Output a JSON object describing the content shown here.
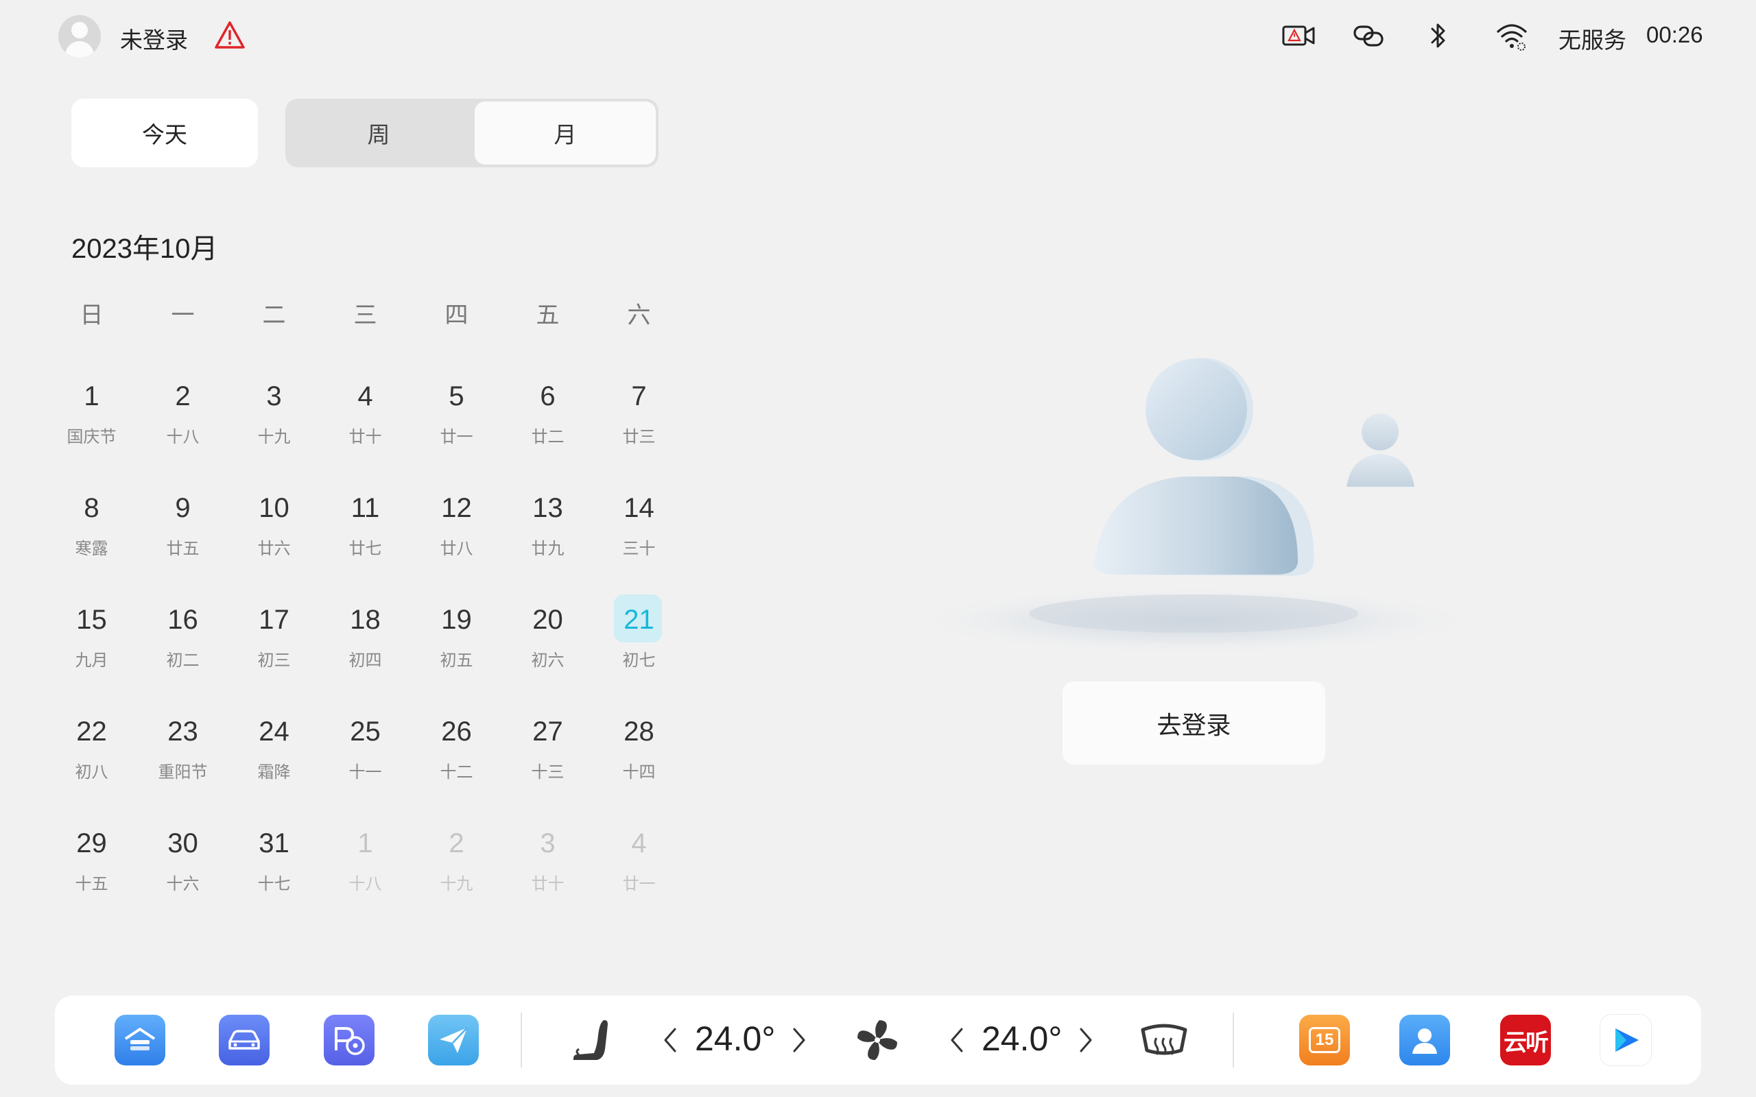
{
  "status_bar": {
    "user_label": "未登录",
    "network": "无服务",
    "time": "00:26"
  },
  "view_switch": {
    "today": "今天",
    "week": "周",
    "month": "月",
    "selected": "月"
  },
  "calendar": {
    "month_title": "2023年10月",
    "weekdays": [
      "日",
      "一",
      "二",
      "三",
      "四",
      "五",
      "六"
    ],
    "days": [
      {
        "num": "1",
        "lunar": "国庆节"
      },
      {
        "num": "2",
        "lunar": "十八"
      },
      {
        "num": "3",
        "lunar": "十九"
      },
      {
        "num": "4",
        "lunar": "廿十"
      },
      {
        "num": "5",
        "lunar": "廿一"
      },
      {
        "num": "6",
        "lunar": "廿二"
      },
      {
        "num": "7",
        "lunar": "廿三"
      },
      {
        "num": "8",
        "lunar": "寒露"
      },
      {
        "num": "9",
        "lunar": "廿五"
      },
      {
        "num": "10",
        "lunar": "廿六"
      },
      {
        "num": "11",
        "lunar": "廿七"
      },
      {
        "num": "12",
        "lunar": "廿八"
      },
      {
        "num": "13",
        "lunar": "廿九"
      },
      {
        "num": "14",
        "lunar": "三十"
      },
      {
        "num": "15",
        "lunar": "九月"
      },
      {
        "num": "16",
        "lunar": "初二"
      },
      {
        "num": "17",
        "lunar": "初三"
      },
      {
        "num": "18",
        "lunar": "初四"
      },
      {
        "num": "19",
        "lunar": "初五"
      },
      {
        "num": "20",
        "lunar": "初六"
      },
      {
        "num": "21",
        "lunar": "初七",
        "today": true
      },
      {
        "num": "22",
        "lunar": "初八"
      },
      {
        "num": "23",
        "lunar": "重阳节"
      },
      {
        "num": "24",
        "lunar": "霜降"
      },
      {
        "num": "25",
        "lunar": "十一"
      },
      {
        "num": "26",
        "lunar": "十二"
      },
      {
        "num": "27",
        "lunar": "十三"
      },
      {
        "num": "28",
        "lunar": "十四"
      },
      {
        "num": "29",
        "lunar": "十五"
      },
      {
        "num": "30",
        "lunar": "十六"
      },
      {
        "num": "31",
        "lunar": "十七"
      },
      {
        "num": "1",
        "lunar": "十八",
        "other": true
      },
      {
        "num": "2",
        "lunar": "十九",
        "other": true
      },
      {
        "num": "3",
        "lunar": "廿十",
        "other": true
      },
      {
        "num": "4",
        "lunar": "廿一",
        "other": true
      }
    ]
  },
  "login": {
    "button_label": "去登录"
  },
  "dock": {
    "left_temp": "24.0°",
    "right_temp": "24.0°",
    "calendar_app_badge": "15",
    "music_app_label": "云听",
    "icons": [
      "home-icon",
      "car-icon",
      "parking-assist-icon",
      "navigation-icon",
      "seat-heat-icon",
      "fan-icon",
      "rear-defrost-icon",
      "calendar-app-icon",
      "contacts-app-icon",
      "music-app-icon",
      "video-app-icon"
    ],
    "colors": {
      "blue_app": "#3f8ef5",
      "purple_app": "#5c6cf0",
      "orange_app": "#f6932b",
      "red_app": "#d7141b",
      "today_highlight": "#16b8d8"
    }
  }
}
